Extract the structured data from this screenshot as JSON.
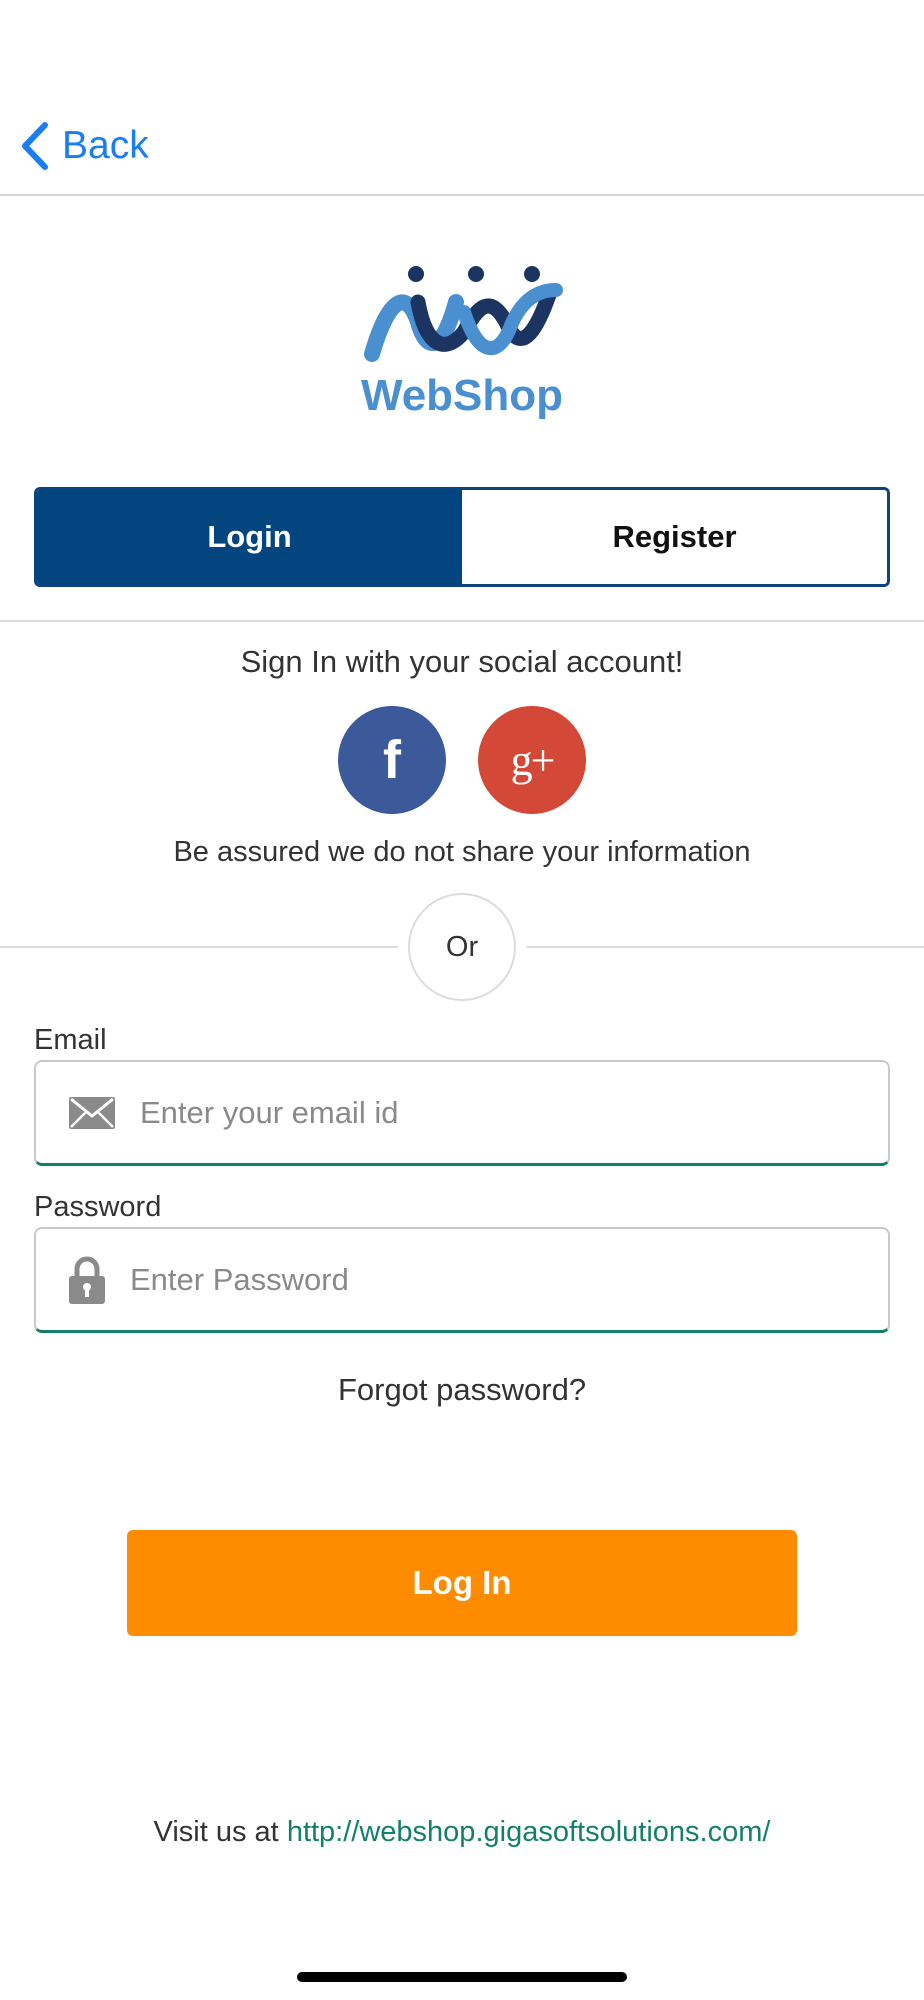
{
  "nav": {
    "back_label": "Back"
  },
  "logo": {
    "text": "WebShop"
  },
  "tabs": [
    {
      "label": "Login",
      "active": true
    },
    {
      "label": "Register",
      "active": false
    }
  ],
  "social": {
    "heading": "Sign In with your social account!",
    "facebook_glyph": "f",
    "google_glyph": "g+",
    "assurance": "Be assured we do not share your information"
  },
  "separator": {
    "label": "Or"
  },
  "form": {
    "email_label": "Email",
    "email_placeholder": "Enter your email id",
    "password_label": "Password",
    "password_placeholder": "Enter Password",
    "forgot_label": "Forgot password?",
    "submit_label": "Log In"
  },
  "footer": {
    "visit_prefix": "Visit us at",
    "url": "http://webshop.gigasoftsolutions.com/"
  },
  "colors": {
    "accent_blue": "#1a7df2",
    "tab_active": "#03467f",
    "facebook": "#3c5a9a",
    "google": "#d34836",
    "login_button": "#ff8c00",
    "link": "#14806b"
  },
  "icons": {
    "back": "chevron-left-icon",
    "email": "envelope-icon",
    "password": "lock-icon",
    "facebook": "facebook-icon",
    "google": "google-plus-icon"
  }
}
